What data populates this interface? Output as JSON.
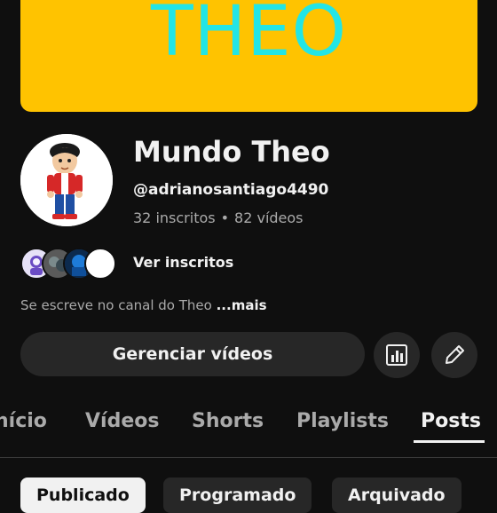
{
  "banner": {
    "text": "THEO"
  },
  "channel": {
    "name": "Mundo Theo",
    "handle": "@adrianosantiago4490",
    "subscribers": "32 inscritos",
    "separator": "•",
    "videos": "82 vídeos",
    "see_subscribers": "Ver inscritos",
    "description": "Se escreve no canal do Theo",
    "more": "...mais"
  },
  "actions": {
    "manage_videos": "Gerenciar vídeos",
    "analytics_icon": "analytics-icon",
    "edit_icon": "pencil-icon"
  },
  "tabs": [
    "nício",
    "Vídeos",
    "Shorts",
    "Playlists",
    "Posts"
  ],
  "active_tab": "Posts",
  "chips": [
    "Publicado",
    "Programado",
    "Arquivado"
  ],
  "active_chip": "Publicado",
  "colors": {
    "background": "#0f0f0f",
    "banner": "#ffc300",
    "banner_text": "#23e5e5",
    "button": "#272727"
  }
}
